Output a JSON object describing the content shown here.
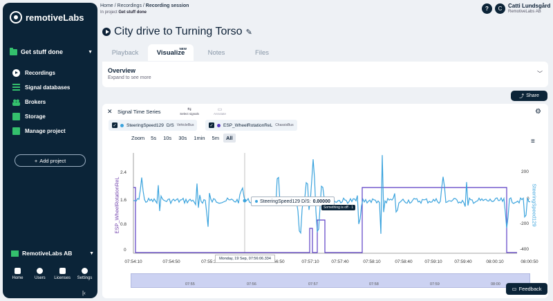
{
  "sidebar": {
    "brand": "remotiveLabs",
    "project": "Get stuff done",
    "items": [
      {
        "label": "Recordings",
        "icon": "recordings-icon"
      },
      {
        "label": "Signal databases",
        "icon": "signal-databases-icon"
      },
      {
        "label": "Brokers",
        "icon": "brokers-icon"
      },
      {
        "label": "Storage",
        "icon": "storage-icon"
      },
      {
        "label": "Manage project",
        "icon": "manage-project-icon"
      }
    ],
    "add_project": "Add project",
    "org": "RemotiveLabs AB",
    "bottom": [
      {
        "label": "Home",
        "icon": "home-icon"
      },
      {
        "label": "Users",
        "icon": "users-icon"
      },
      {
        "label": "Licenses",
        "icon": "licenses-icon"
      },
      {
        "label": "Settings",
        "icon": "settings-icon"
      }
    ]
  },
  "header": {
    "crumbs": [
      "Home",
      "Recordings",
      "Recording session"
    ],
    "in_project_prefix": "In project",
    "in_project": "Get stuff done",
    "user_name": "Catti Lundsgård",
    "user_org": "RemotiveLabs AB",
    "avatar_initial": "C",
    "help": "?"
  },
  "title": "City drive to Turning Torso",
  "tabs": [
    {
      "label": "Playback"
    },
    {
      "label": "Visualize",
      "badge": "NEW",
      "active": true
    },
    {
      "label": "Notes"
    },
    {
      "label": "Files"
    }
  ],
  "overview": {
    "title": "Overview",
    "subtitle": "Expand to see more"
  },
  "share": "Share",
  "panel": {
    "title": "Signal Time Series",
    "tools": [
      "Select signals",
      "Annotate"
    ],
    "chips": [
      {
        "signal": "SteeringSpeed129",
        "unit": "D/S",
        "bus": "VehicleBus",
        "color": "#3aa3dd"
      },
      {
        "signal": "ESP_WheelRotationReL",
        "bus": "ChassisBus",
        "color": "#5b3cc4"
      }
    ],
    "zoom_label": "Zoom",
    "zoom_options": [
      "5s",
      "10s",
      "30s",
      "1min",
      "5m",
      "All"
    ],
    "zoom_selected": "All"
  },
  "chart_data": {
    "type": "line",
    "left_ylabel": "ESP_WheelRotationReL",
    "right_ylabel": "SteeringSpeed129",
    "left_ticks": [
      "2.4",
      "1.6",
      "0.8",
      "0"
    ],
    "right_ticks": [
      "200",
      "0",
      "-200",
      "-400"
    ],
    "x_ticks": [
      "07:54:10",
      "07:54:50",
      "07:55:3",
      "07:56:10",
      "07:56:50",
      "07:57:10",
      "07:57:40",
      "07:58:10",
      "07:58:40",
      "07:59:10",
      "07:59:40",
      "08:00:10",
      "08:00:50"
    ],
    "tooltip_signal": "SteeringSpeed129 D/S:",
    "tooltip_value": "0.00000",
    "tag_text": "Something is off · 1",
    "x_tooltip": "Monday, 19 Sep, 07:56:06.334",
    "navigator_ticks": [
      "07:55",
      "07:56",
      "07:57",
      "07:58",
      "07:59",
      "08:00"
    ],
    "series": [
      {
        "name": "SteeringSpeed129",
        "color": "#3aa3dd"
      },
      {
        "name": "ESP_WheelRotationReL",
        "color": "#5b3cc4"
      }
    ]
  },
  "feedback": "Feedback"
}
